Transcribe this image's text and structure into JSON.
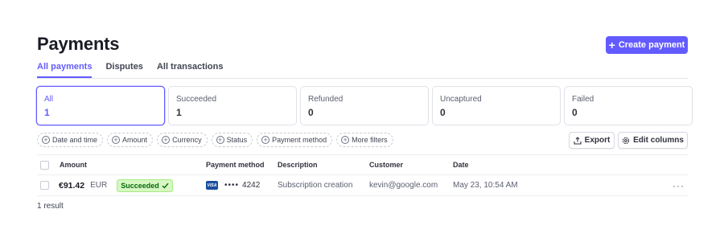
{
  "header": {
    "title": "Payments",
    "create_button": "Create payment"
  },
  "tabs": [
    {
      "label": "All payments",
      "active": true
    },
    {
      "label": "Disputes",
      "active": false
    },
    {
      "label": "All transactions",
      "active": false
    }
  ],
  "status_cards": [
    {
      "label": "All",
      "count": "1",
      "active": true
    },
    {
      "label": "Succeeded",
      "count": "1",
      "active": false
    },
    {
      "label": "Refunded",
      "count": "0",
      "active": false
    },
    {
      "label": "Uncaptured",
      "count": "0",
      "active": false
    },
    {
      "label": "Failed",
      "count": "0",
      "active": false
    }
  ],
  "filters": [
    "Date and time",
    "Amount",
    "Currency",
    "Status",
    "Payment method",
    "More filters"
  ],
  "toolbar": {
    "export_label": "Export",
    "edit_columns_label": "Edit columns"
  },
  "table": {
    "columns": [
      "Amount",
      "Payment method",
      "Description",
      "Customer",
      "Date"
    ],
    "rows": [
      {
        "amount": "€91.42",
        "currency": "EUR",
        "status": "Succeeded",
        "card_brand": "VISA",
        "card_dots": "••••",
        "card_last4": "4242",
        "description": "Subscription creation",
        "customer": "kevin@google.com",
        "date": "May 23, 10:54 AM",
        "more": "···"
      }
    ]
  },
  "footer": {
    "result_count": "1 result"
  },
  "colors": {
    "accent": "#635bff",
    "success_bg": "#d7f7c2",
    "success_text": "#05690d",
    "visa_blue": "#1a4ea0"
  }
}
